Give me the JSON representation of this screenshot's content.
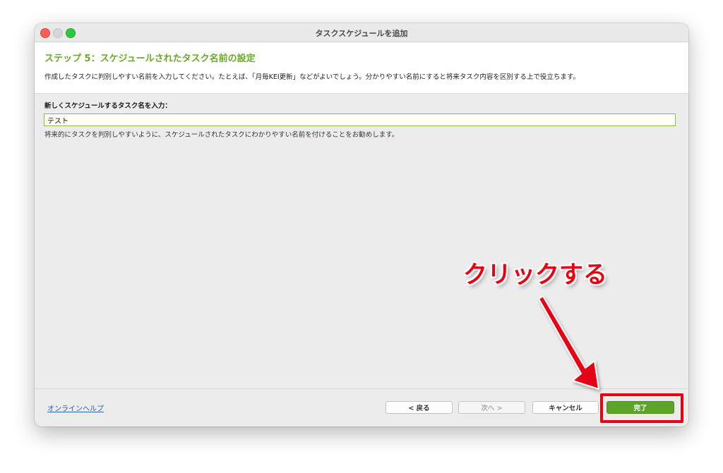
{
  "window": {
    "title": "タスクスケジュールを追加"
  },
  "header": {
    "step_title": "ステップ 5：スケジュールされたタスク名前の設定",
    "step_description": "作成したタスクに判別しやすい名前を入力してください。たとえば、「月毎KEI更新」などがよいでしょう。分かりやすい名前にすると将来タスク内容を区別する上で役立ちます。"
  },
  "form": {
    "field_label": "新しくスケジュールするタスク名を入力：",
    "task_name_value": "テスト",
    "hint": "将来的にタスクを判別しやすいように、スケジュールされたタスクにわかりやすい名前を付けることをお勧めします。"
  },
  "footer": {
    "help_link": "オンラインヘルプ",
    "back_label": "< 戻る",
    "next_label": "次へ >",
    "cancel_label": "キャンセル",
    "finish_label": "完了"
  },
  "annotation": {
    "text": "クリックする",
    "color": "#e60012"
  },
  "colors": {
    "accent_green": "#6aa82c",
    "finish_button": "#5ca52a"
  }
}
